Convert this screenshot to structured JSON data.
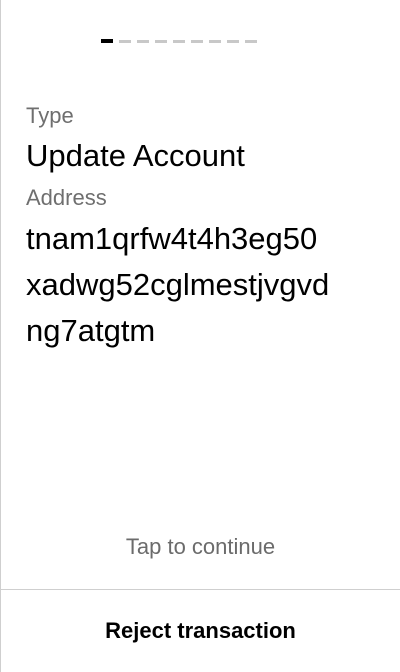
{
  "pager": {
    "total": 9,
    "active_index": 0
  },
  "fields": {
    "type_label": "Type",
    "type_value": "Update Account",
    "address_label": "Address",
    "address_value_line1": "tnam1qrfw4t4h3eg50",
    "address_value_line2": "xadwg52cglmestjvgvd",
    "address_value_line3": "ng7atgtm"
  },
  "hint": {
    "tap_text": "Tap to continue"
  },
  "actions": {
    "reject_label": "Reject transaction"
  },
  "colors": {
    "active_dot": "#000000",
    "inactive_dot": "#c8c8c8",
    "label_gray": "#6f6f6f",
    "divider": "#cfcfcf"
  }
}
